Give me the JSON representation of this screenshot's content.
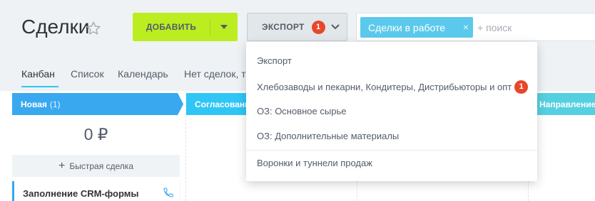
{
  "header": {
    "title": "Сделки",
    "add_label": "ДОБАВИТЬ",
    "export_label": "ЭКСПОРТ",
    "export_badge": "1",
    "search_chip": "Сделки в работе",
    "search_chip_close": "×",
    "search_placeholder": "+ поиск"
  },
  "tabs": [
    "Канбан",
    "Список",
    "Календарь",
    "Нет сделок, т"
  ],
  "stages": [
    {
      "name": "Новая",
      "count": "(1)",
      "color": "#39a8ef"
    },
    {
      "name": "Согласовани",
      "count": "",
      "color": "#2fc6f6"
    },
    {
      "name": "Направление",
      "count": "",
      "color": "#55d0e0"
    }
  ],
  "column": {
    "sum": "0 ₽",
    "quick_deal": "Быстрая сделка",
    "card_title": "Заполнение CRM-формы"
  },
  "export_menu": {
    "items": [
      {
        "label": "Экспорт",
        "badge": ""
      },
      {
        "label": "Хлебозаводы и пекарни, Кондитеры, Дистрибьюторы и опт",
        "badge": "1"
      },
      {
        "label": "ОЗ: Основное сырье",
        "badge": ""
      },
      {
        "label": "ОЗ: Дополнительные материалы",
        "badge": ""
      },
      {
        "label": "Воронки и туннели продаж",
        "badge": ""
      }
    ]
  },
  "colors": {
    "add_button": "#bbed21",
    "badge": "#e8472a",
    "chip": "#5bc9ec",
    "accent": "#2fc6f6"
  }
}
